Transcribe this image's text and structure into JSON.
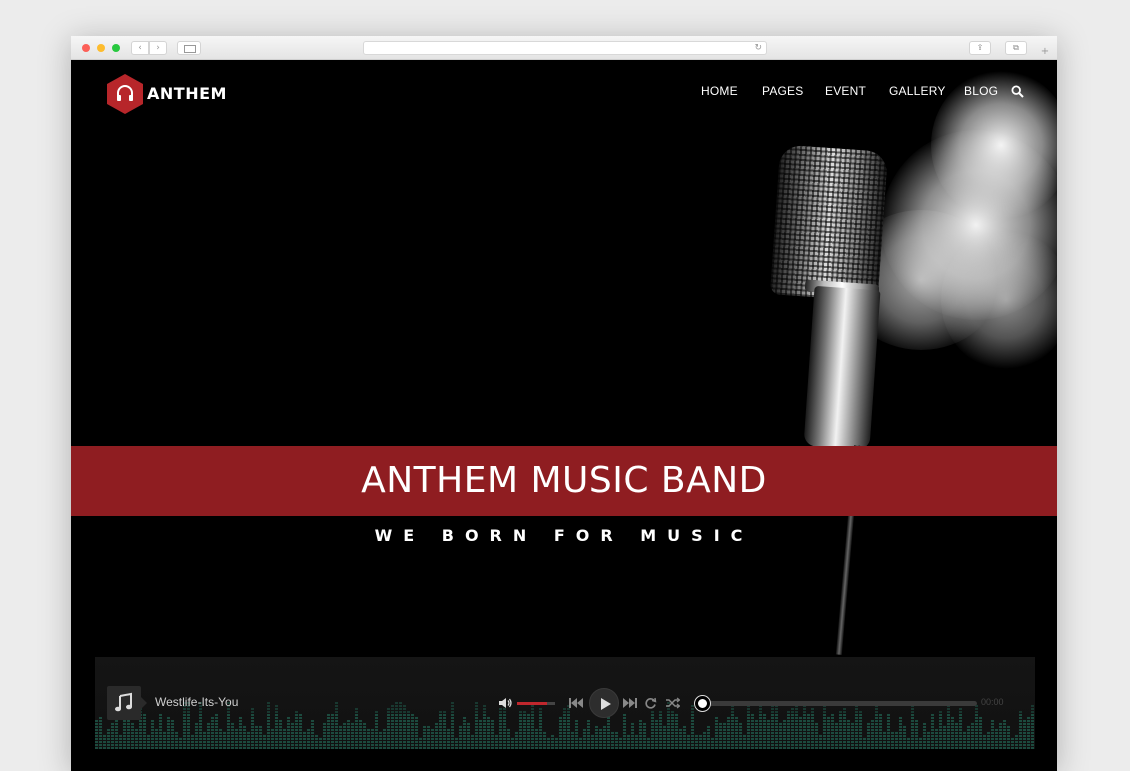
{
  "site": {
    "brand": "ANTHEM",
    "nav": [
      "HOME",
      "PAGES",
      "EVENT",
      "GALLERY",
      "BLOG"
    ]
  },
  "hero": {
    "title": "ANTHEM MUSIC BAND",
    "tagline": "WE BORN FOR MUSIC"
  },
  "player": {
    "track": "Westlife-Its-You",
    "time": "00:00",
    "volume": 0.8,
    "progress": 0
  },
  "colors": {
    "accent": "#b7262a",
    "banner": "#8f1d21",
    "eq": "#1c4a3e"
  },
  "icons": {
    "logo": "headphones-icon",
    "search": "search-icon",
    "album": "music-note-icon",
    "volume": "volume-icon",
    "prev": "prev-icon",
    "play": "play-icon",
    "next": "next-icon",
    "repeat": "repeat-icon",
    "shuffle": "shuffle-icon"
  }
}
